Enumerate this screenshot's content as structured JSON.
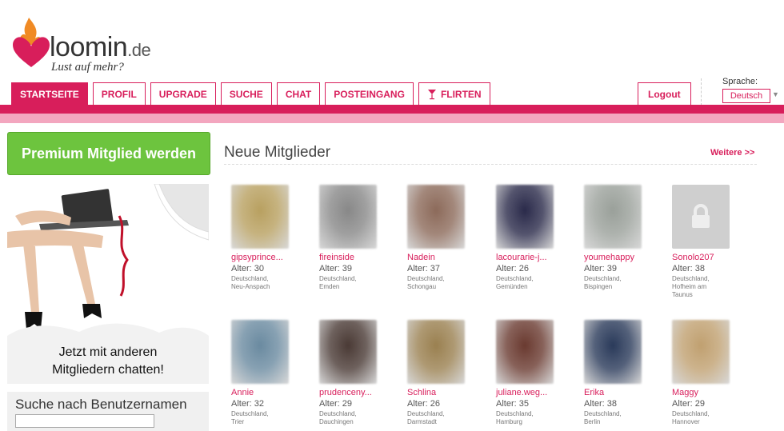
{
  "logo": {
    "brand": "loomin",
    "tld": ".de",
    "slogan": "Lust auf mehr?"
  },
  "nav": {
    "tabs": [
      "STARTSEITE",
      "PROFIL",
      "UPGRADE",
      "SUCHE",
      "CHAT",
      "POSTEINGANG",
      "FLIRTEN"
    ],
    "logout": "Logout"
  },
  "language": {
    "label": "Sprache:",
    "selected": "Deutsch"
  },
  "sidebar": {
    "premium_button": "Premium Mitglied werden",
    "promo_line1": "Jetzt mit anderen",
    "promo_line2": "Mitgliedern chatten!",
    "search_title": "Suche nach Benutzernamen"
  },
  "main": {
    "title": "Neue Mitglieder",
    "more_link": "Weitere >>",
    "members": [
      {
        "name": "gipsyprince...",
        "age": "Alter: 30",
        "country": "Deutschland,",
        "city": "Neu-Anspach",
        "color": "#b8a060"
      },
      {
        "name": "fireinside",
        "age": "Alter: 39",
        "country": "Deutschland,",
        "city": "Emden",
        "color": "#888888"
      },
      {
        "name": "Nadein",
        "age": "Alter: 37",
        "country": "Deutschland,",
        "city": "Schongau",
        "color": "#8c6a5a"
      },
      {
        "name": "lacourarie-j...",
        "age": "Alter: 26",
        "country": "Deutschland,",
        "city": "Gemünden",
        "color": "#2a2a4a"
      },
      {
        "name": "youmehappy",
        "age": "Alter: 39",
        "country": "Deutschland,",
        "city": "Bispingen",
        "color": "#9aa09a"
      },
      {
        "name": "Sonolo207",
        "age": "Alter: 38",
        "country": "Deutschland,",
        "city": "Hofheim am",
        "city2": "Taunus",
        "color": "#cfcfcf",
        "locked": true
      },
      {
        "name": "Annie",
        "age": "Alter: 32",
        "country": "Deutschland,",
        "city": "Trier",
        "color": "#6a8aa0"
      },
      {
        "name": "prudenceny...",
        "age": "Alter: 29",
        "country": "Deutschland,",
        "city": "Dauchingen",
        "color": "#4a3a35"
      },
      {
        "name": "Schlina",
        "age": "Alter: 26",
        "country": "Deutschland,",
        "city": "Darmstadt",
        "color": "#9a8050"
      },
      {
        "name": "juliane.weg...",
        "age": "Alter: 35",
        "country": "Deutschland,",
        "city": "Hamburg",
        "color": "#6a3a30"
      },
      {
        "name": "Erika",
        "age": "Alter: 38",
        "country": "Deutschland,",
        "city": "Berlin",
        "color": "#2a3a5a"
      },
      {
        "name": "Maggy",
        "age": "Alter: 29",
        "country": "Deutschland,",
        "city": "Hannover",
        "color": "#c0a070"
      }
    ]
  }
}
